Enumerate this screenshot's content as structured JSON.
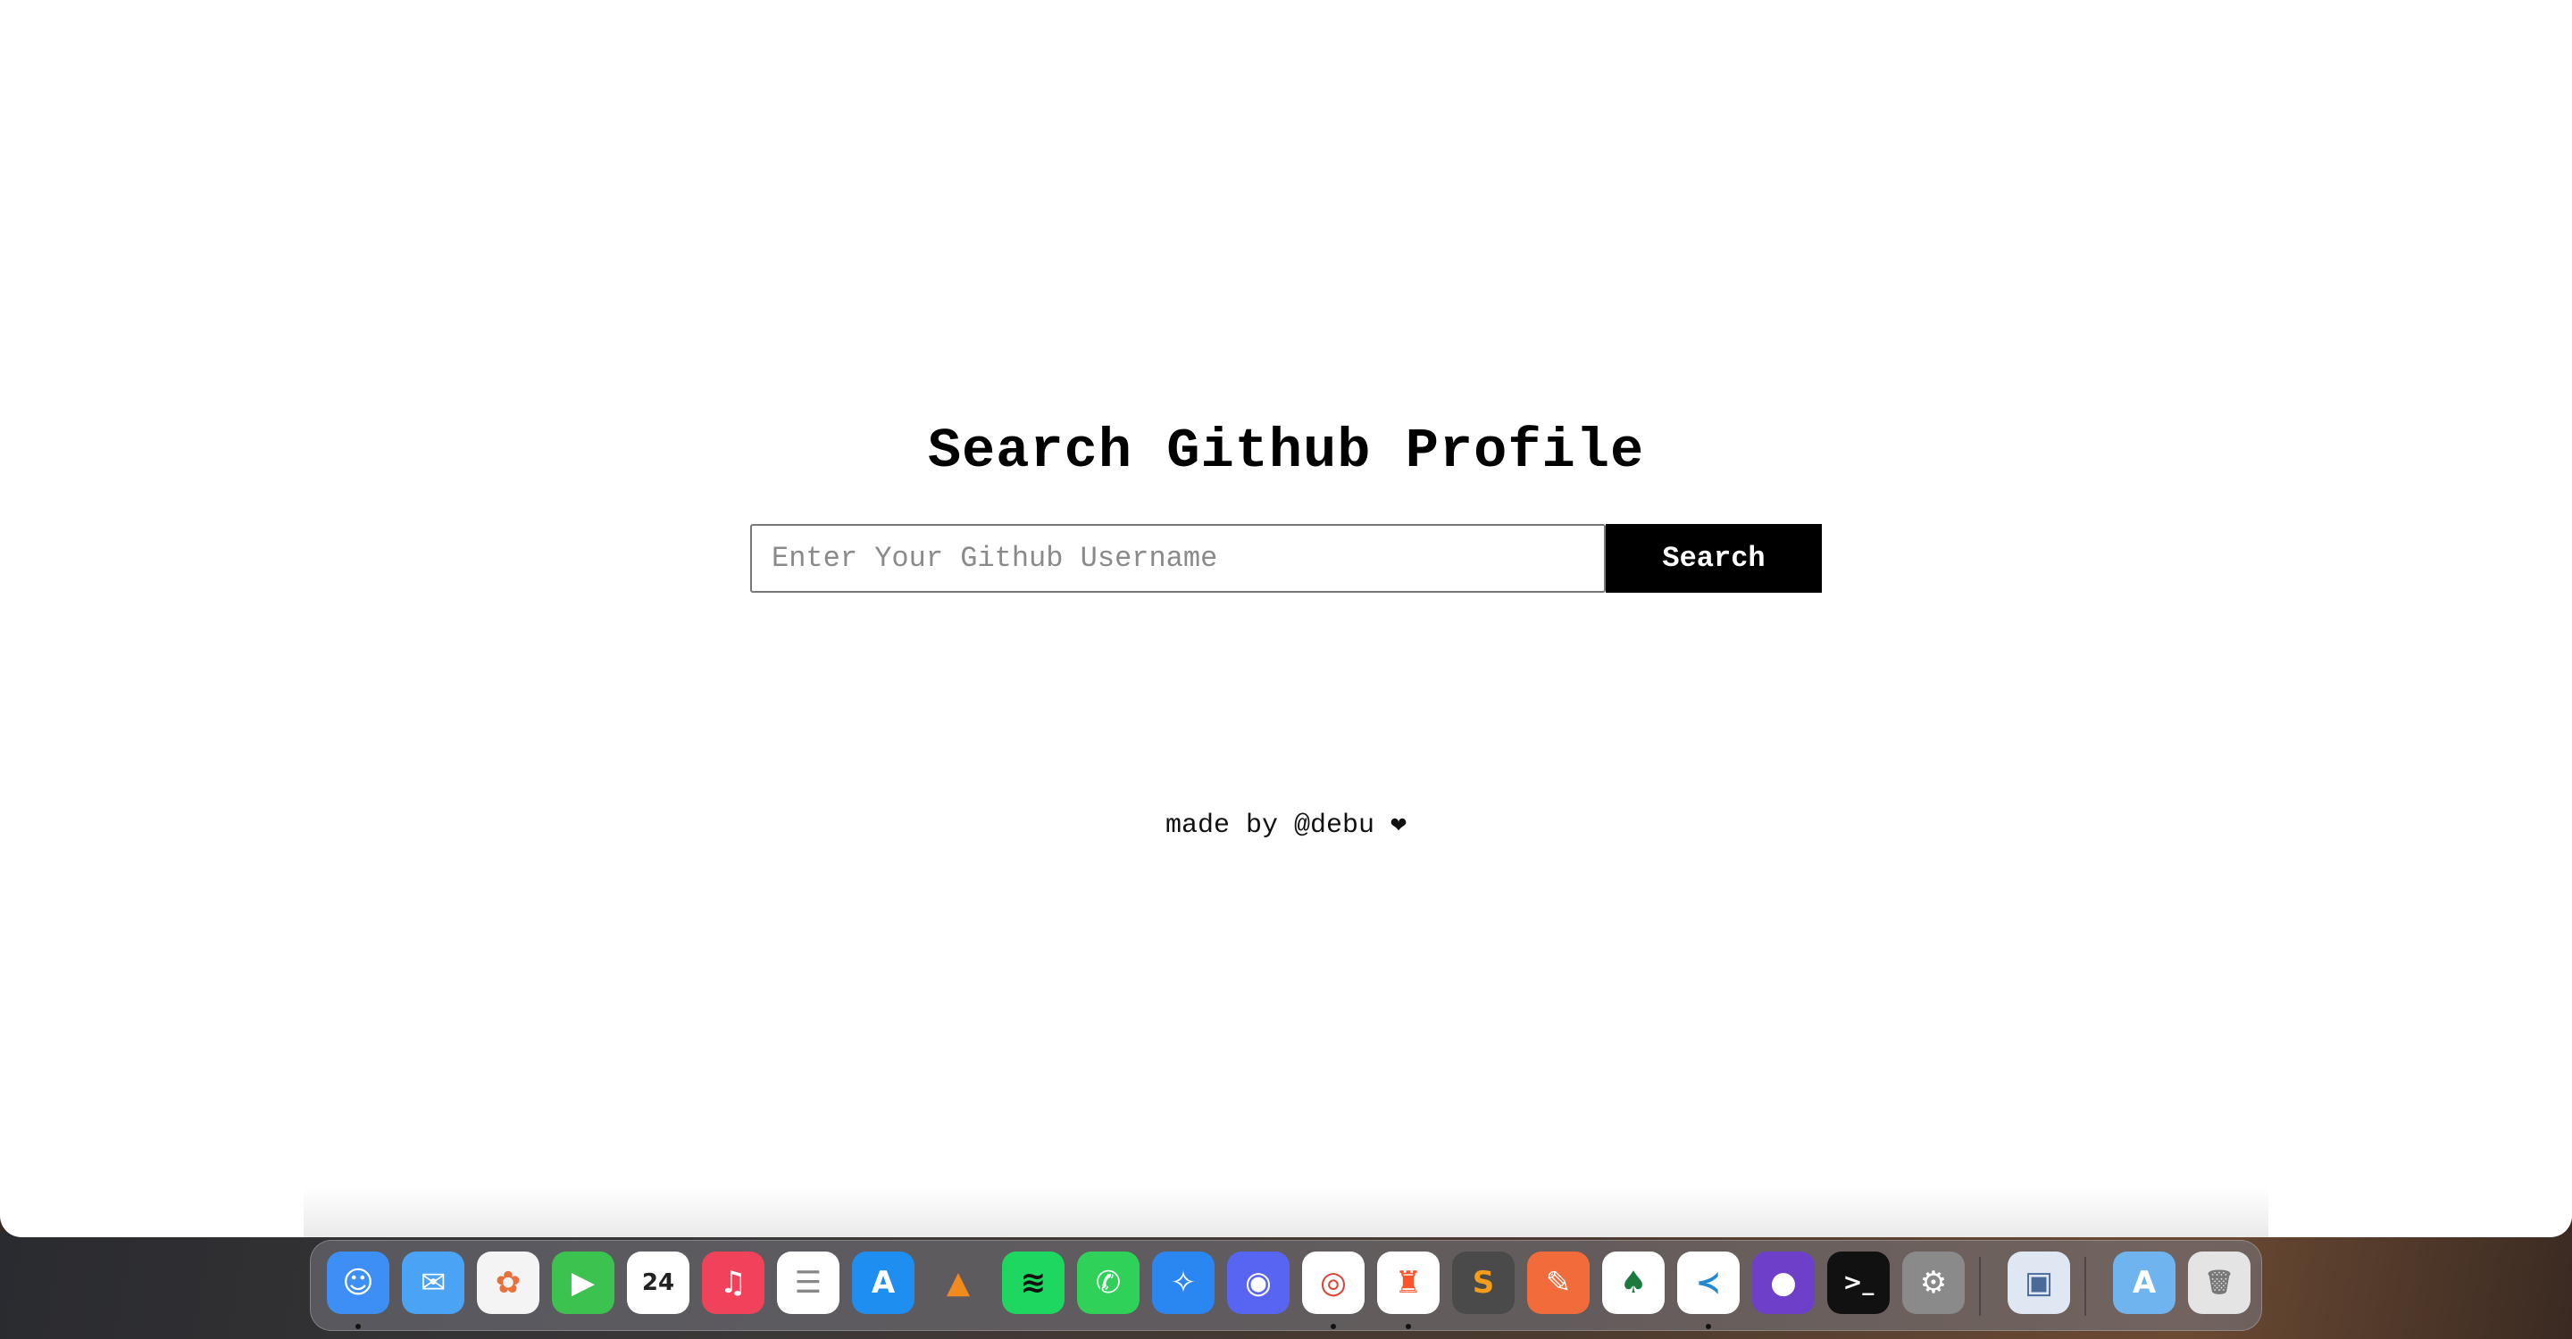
{
  "page": {
    "title": "Search Github Profile",
    "search_placeholder": "Enter Your Github Username",
    "search_value": "",
    "search_button": "Search",
    "footer": "made by @debu ❤"
  },
  "dock": {
    "items": [
      {
        "name": "finder-icon",
        "glyph": "☺",
        "bg": "#3d8ff5",
        "running": true
      },
      {
        "name": "mail-icon",
        "glyph": "✉",
        "bg": "#4aa3f5",
        "running": false
      },
      {
        "name": "photos-icon",
        "glyph": "✿",
        "bg": "#f4f4f4",
        "fg": "#e8703a",
        "running": false
      },
      {
        "name": "facetime-icon",
        "glyph": "▶",
        "bg": "#3cc24e",
        "running": false
      },
      {
        "name": "calendar-icon",
        "glyph": "24",
        "bg": "#ffffff",
        "fg": "#222",
        "running": false
      },
      {
        "name": "music-icon",
        "glyph": "♫",
        "bg": "#f0425a",
        "running": false
      },
      {
        "name": "reminders-icon",
        "glyph": "☰",
        "bg": "#ffffff",
        "fg": "#888",
        "running": false
      },
      {
        "name": "app-store-icon",
        "glyph": "A",
        "bg": "#1e8ef0",
        "running": false
      },
      {
        "name": "vlc-icon",
        "glyph": "▲",
        "bg": "transparent",
        "fg": "#f28a1e",
        "running": false
      },
      {
        "name": "spotify-icon",
        "glyph": "≋",
        "bg": "#1ed760",
        "fg": "#111",
        "running": false
      },
      {
        "name": "whatsapp-icon",
        "glyph": "✆",
        "bg": "#2fd158",
        "running": false
      },
      {
        "name": "safari-icon",
        "glyph": "✧",
        "bg": "#2a86f0",
        "running": false
      },
      {
        "name": "discord-icon",
        "glyph": "◉",
        "bg": "#5865f2",
        "running": false
      },
      {
        "name": "chrome-icon",
        "glyph": "◎",
        "bg": "#ffffff",
        "fg": "#db4437",
        "running": true
      },
      {
        "name": "brave-icon",
        "glyph": "♜",
        "bg": "#ffffff",
        "fg": "#fb542b",
        "running": true
      },
      {
        "name": "sublime-text-icon",
        "glyph": "S",
        "bg": "#4a4a4a",
        "fg": "#f59c1a",
        "running": false
      },
      {
        "name": "postman-icon",
        "glyph": "✎",
        "bg": "#f26b3a",
        "running": false
      },
      {
        "name": "mongodb-compass-icon",
        "glyph": "♠",
        "bg": "#ffffff",
        "fg": "#1b7a3e",
        "running": false
      },
      {
        "name": "vscode-icon",
        "glyph": "≺",
        "bg": "#ffffff",
        "fg": "#1f8ad2",
        "running": true
      },
      {
        "name": "github-desktop-icon",
        "glyph": "●",
        "bg": "#6e40c9",
        "running": false
      },
      {
        "name": "terminal-icon",
        "glyph": ">_",
        "bg": "#111111",
        "running": false
      },
      {
        "name": "system-settings-icon",
        "glyph": "⚙",
        "bg": "#8a8a8a",
        "running": false
      },
      {
        "name": "preview-icon",
        "glyph": "▣",
        "bg": "#dfe8f2",
        "fg": "#4a6a9a",
        "running": false
      },
      {
        "name": "applications-folder-icon",
        "glyph": "A",
        "bg": "#6fb4ef",
        "running": false
      },
      {
        "name": "trash-icon",
        "glyph": "🗑",
        "bg": "#e4e4e4",
        "fg": "#777",
        "running": false
      }
    ]
  }
}
